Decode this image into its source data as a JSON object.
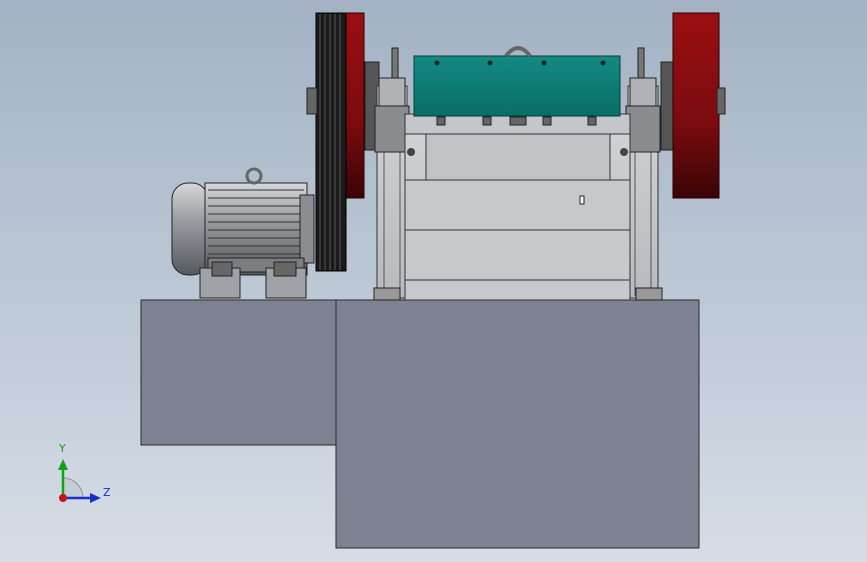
{
  "viewport": {
    "colors": {
      "background_top": "#a3b2c4",
      "background_bottom": "#d6dde6",
      "foundation": "#7e8293",
      "crusher_body": "#c8cacc",
      "crusher_edge": "#3a3a3a",
      "jaw_cover": "#0b7a72",
      "flywheel_red": "#8a0f12",
      "pulley_black": "#1a1a1a",
      "motor_body": "#9a9ea2"
    }
  },
  "triad": {
    "y_label": "Y",
    "z_label": "Z",
    "y_color": "#12a312",
    "z_color": "#1a2fc8",
    "origin_color": "#c81414"
  }
}
